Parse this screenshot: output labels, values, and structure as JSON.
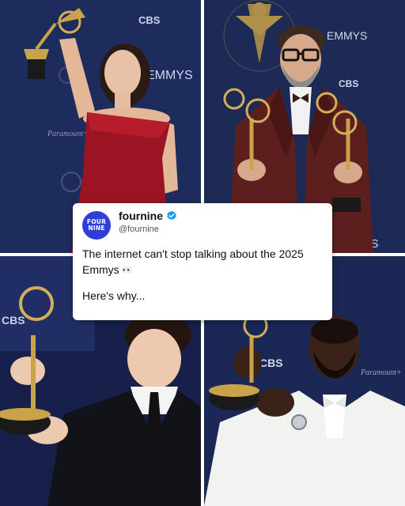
{
  "backdrop_texts": {
    "p1_cbs": "CBS",
    "p1_emmys": "EMMYS",
    "p1_paramount": "Paramount+",
    "p2_emmys": "EMMYS",
    "p2_cbs": "CBS",
    "p2_emmys_bottom": "MYS",
    "p3_cbs": "CBS",
    "p4_cbs": "CBS",
    "p4_paramount": "Paramount+"
  },
  "post": {
    "avatar_line1": "FOUR",
    "avatar_line2": "NINE",
    "username": "fournine",
    "handle": "@fournine",
    "line1": "The internet can't stop talking about the 2025 Emmys",
    "emoji": "👀",
    "line2": "Here's why..."
  },
  "colors": {
    "backdrop": "#1c2a55",
    "avatar": "#2d3fd6",
    "verified": "#1d9bf0",
    "gold": "#c9a24a"
  }
}
